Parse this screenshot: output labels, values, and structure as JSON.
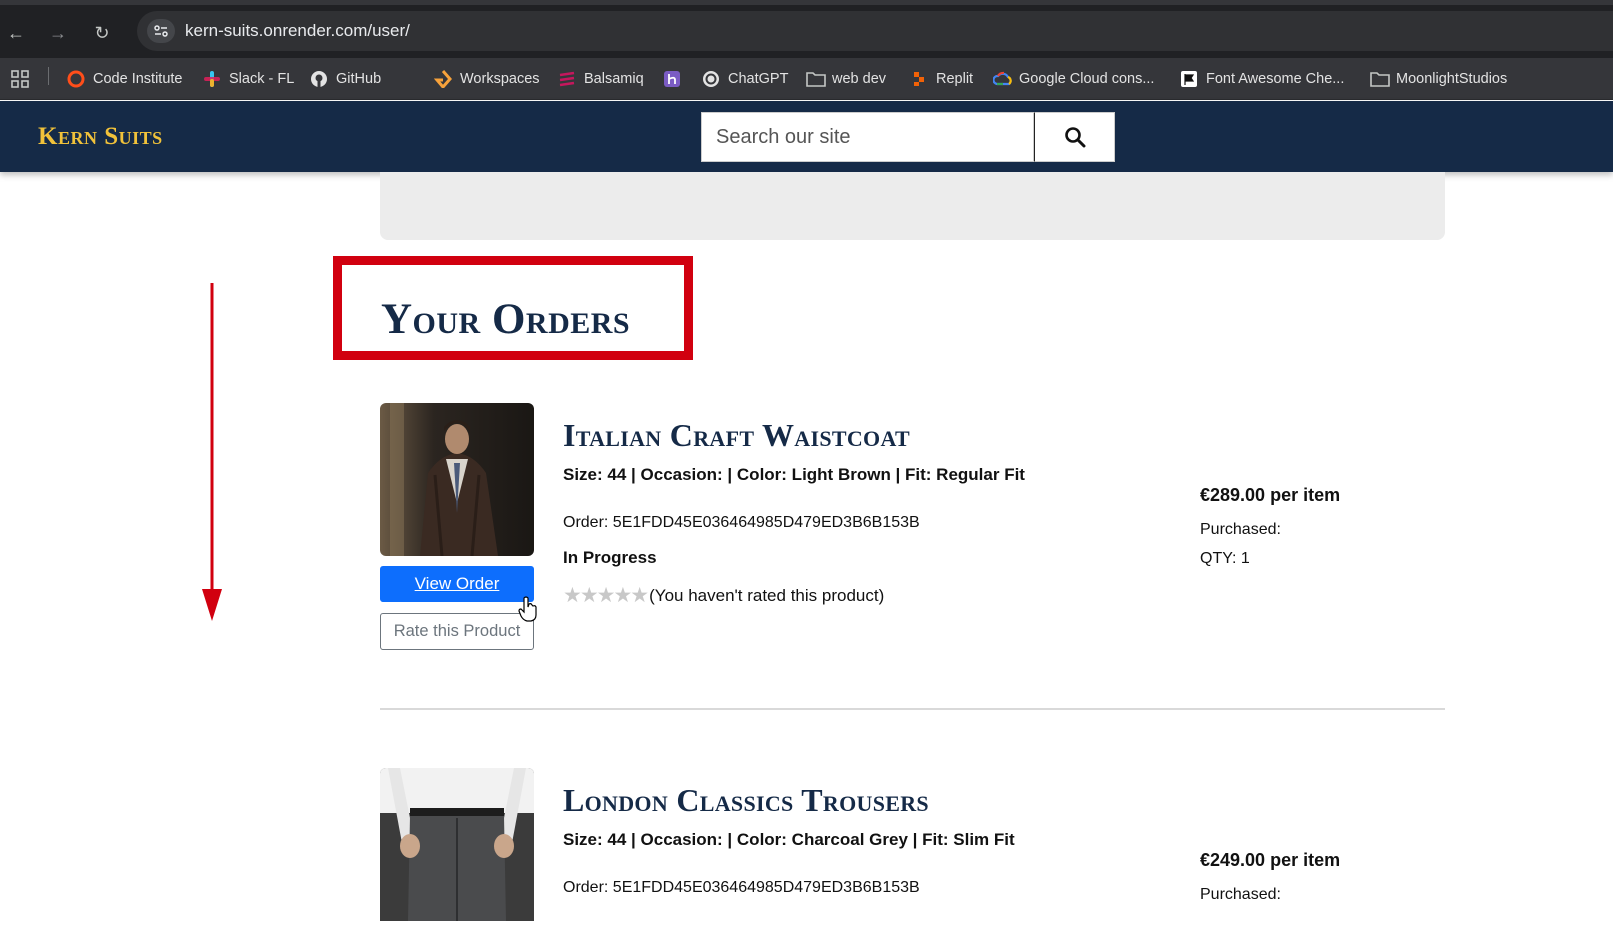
{
  "browser": {
    "url": "kern-suits.onrender.com/user/",
    "bookmarks": [
      {
        "label": "Code Institute",
        "icon": "code-institute-icon"
      },
      {
        "label": "Slack - FL",
        "icon": "slack-icon"
      },
      {
        "label": "GitHub",
        "icon": "github-icon"
      },
      {
        "label": "Workspaces",
        "icon": "workspaces-icon"
      },
      {
        "label": "Balsamiq",
        "icon": "balsamiq-icon"
      },
      {
        "label": "",
        "icon": "heroku-icon"
      },
      {
        "label": "ChatGPT",
        "icon": "chatgpt-icon"
      },
      {
        "label": "web dev",
        "icon": "folder-icon"
      },
      {
        "label": "Replit",
        "icon": "replit-icon"
      },
      {
        "label": "Google Cloud cons...",
        "icon": "google-cloud-icon"
      },
      {
        "label": "Font Awesome Che...",
        "icon": "font-awesome-icon"
      },
      {
        "label": "MoonlightStudios",
        "icon": "folder-icon"
      }
    ]
  },
  "header": {
    "brand": "Kern Suits",
    "search_placeholder": "Search our site"
  },
  "page": {
    "title": "Your Orders"
  },
  "orders": [
    {
      "name": "Italian Craft Waistcoat",
      "details": "Size: 44 | Occasion: | Color: Light Brown | Fit: Regular Fit",
      "order_number": "Order: 5E1FDD45E036464985D479ED3B6B153B",
      "status": "In Progress",
      "stars": "★★★★★",
      "rating_text": "(You haven't rated this product)",
      "price": "€289.00",
      "price_suffix": "per item",
      "purchased": "Purchased:",
      "qty": "QTY: 1",
      "view_label": "View Order",
      "rate_label": "Rate this Product"
    },
    {
      "name": "London Classics Trousers",
      "details": "Size: 44 | Occasion: | Color: Charcoal Grey | Fit: Slim Fit",
      "order_number": "Order: 5E1FDD45E036464985D479ED3B6B153B",
      "price": "€249.00",
      "price_suffix": "per item",
      "purchased": "Purchased:"
    }
  ],
  "colors": {
    "header_bg": "#152a47",
    "brand": "#f1c23a",
    "primary_button": "#0d6efd",
    "annotation": "#d1000f"
  }
}
